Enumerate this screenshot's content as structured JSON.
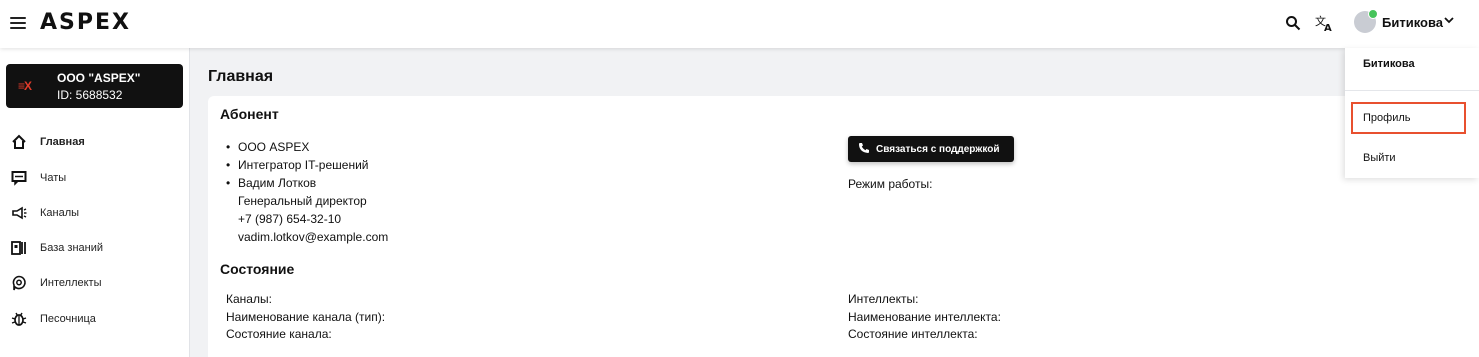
{
  "header": {
    "logo_text": "ASPEX",
    "search_icon": "search-icon",
    "translate_icon": "translate-icon",
    "user_name": "Битикова",
    "user_chevron": "chevron-down-icon"
  },
  "sidebar": {
    "org": {
      "logo_text": "≡X",
      "name": "ООО \"ASPEX\"",
      "id": "ID: 5688532"
    },
    "items": [
      {
        "label": "Главная",
        "icon": "home-icon",
        "active": true
      },
      {
        "label": "Чаты",
        "icon": "chat-icon",
        "active": false
      },
      {
        "label": "Каналы",
        "icon": "megaphone-icon",
        "active": false
      },
      {
        "label": "База знаний",
        "icon": "knowledge-base-icon",
        "active": false
      },
      {
        "label": "Интеллекты",
        "icon": "brain-icon",
        "active": false
      },
      {
        "label": "Песочница",
        "icon": "bug-icon",
        "active": false
      }
    ]
  },
  "main": {
    "page_title": "Главная",
    "subscriber": {
      "title": "Абонент",
      "company": "ООО ASPEX",
      "company_type": "Интегратор IT-решений",
      "contact_name": "Вадим Лотков",
      "contact_role": "Генеральный директор",
      "contact_phone": "+7 (987) 654-32-10",
      "contact_email": "vadim.lotkov@example.com"
    },
    "support_button": "Связаться с поддержкой",
    "work_mode_label": "Режим работы:",
    "status": {
      "title": "Состояние",
      "channels_label": "Каналы:",
      "channel_name_label": "Наименование канала (тип):",
      "channel_state_label": "Состояние канала:",
      "intellects_label": "Интеллекты:",
      "intellect_name_label": "Наименование интеллекта:",
      "intellect_state_label": "Состояние интеллекта:"
    }
  },
  "user_menu": {
    "name": "Битикова",
    "profile": "Профиль",
    "logout": "Выйти"
  },
  "colors": {
    "accent_red": "#e23b2a",
    "highlight_border": "#e8502f",
    "dark": "#111111"
  }
}
